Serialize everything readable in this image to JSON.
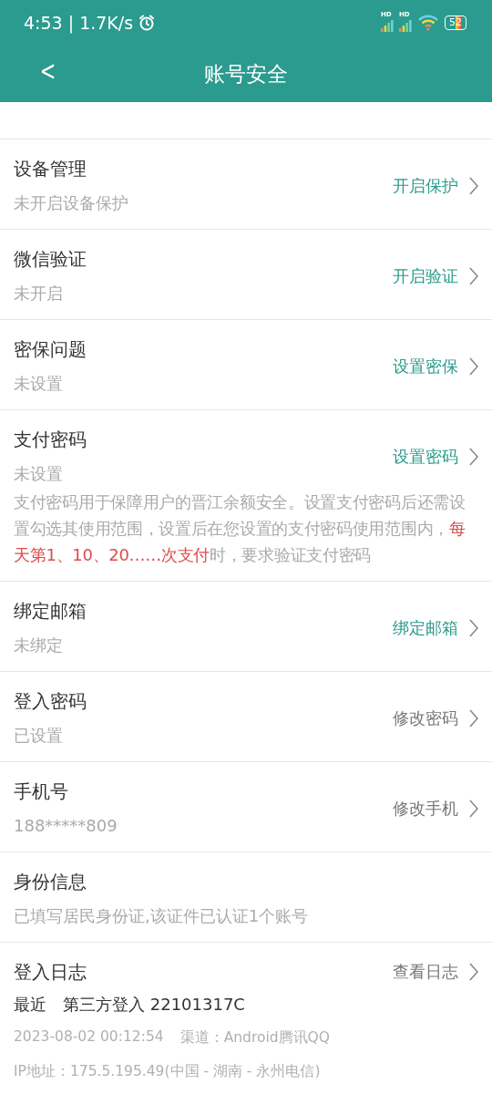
{
  "status_bar": {
    "time": "4:53 | 1.7K/s",
    "signal_labels": [
      "HD",
      "HD"
    ],
    "battery": "52"
  },
  "header": {
    "back": "<",
    "title": "账号安全"
  },
  "rows": [
    {
      "kind": "setting",
      "title": "设备管理",
      "subtitle": "未开启设备保护",
      "action": "开启保护",
      "highlight": true
    },
    {
      "kind": "setting",
      "title": "微信验证",
      "subtitle": "未开启",
      "action": "开启验证",
      "highlight": true
    },
    {
      "kind": "setting",
      "title": "密保问题",
      "subtitle": "未设置",
      "action": "设置密保",
      "highlight": true
    },
    {
      "kind": "setting",
      "title": "支付密码",
      "subtitle": "未设置",
      "action": "设置密码",
      "highlight": true,
      "description": [
        {
          "text": "支付密码用于保障用户的晋江余额安全。设置支付密码后还需设置勾选其使用范围，设置后在您设置的支付密码使用范围内，",
          "emphasis": false
        },
        {
          "text": "每天第1、10、20……次支付",
          "emphasis": true
        },
        {
          "text": "时，要求验证支付密码",
          "emphasis": false
        }
      ]
    },
    {
      "kind": "setting",
      "title": "绑定邮箱",
      "subtitle": "未绑定",
      "action": "绑定邮箱",
      "highlight": true
    },
    {
      "kind": "setting",
      "title": "登入密码",
      "subtitle": "已设置",
      "action": "修改密码",
      "highlight": false
    },
    {
      "kind": "setting",
      "title": "手机号",
      "subtitle": "188*****809",
      "action": "修改手机",
      "highlight": false
    },
    {
      "kind": "setting",
      "title": "身份信息",
      "subtitle": "已填写居民身份证,该证件已认证1个账号"
    },
    {
      "kind": "log",
      "title": "登入日志",
      "action": "查看日志",
      "highlight": false,
      "recent_label": "最近",
      "recent_value": "第三方登入 22101317C",
      "time": "2023-08-02 00:12:54",
      "channel": "渠道：Android腾讯QQ",
      "ip": "IP地址：175.5.195.49(中国 - 湖南 - 永州电信)"
    }
  ]
}
